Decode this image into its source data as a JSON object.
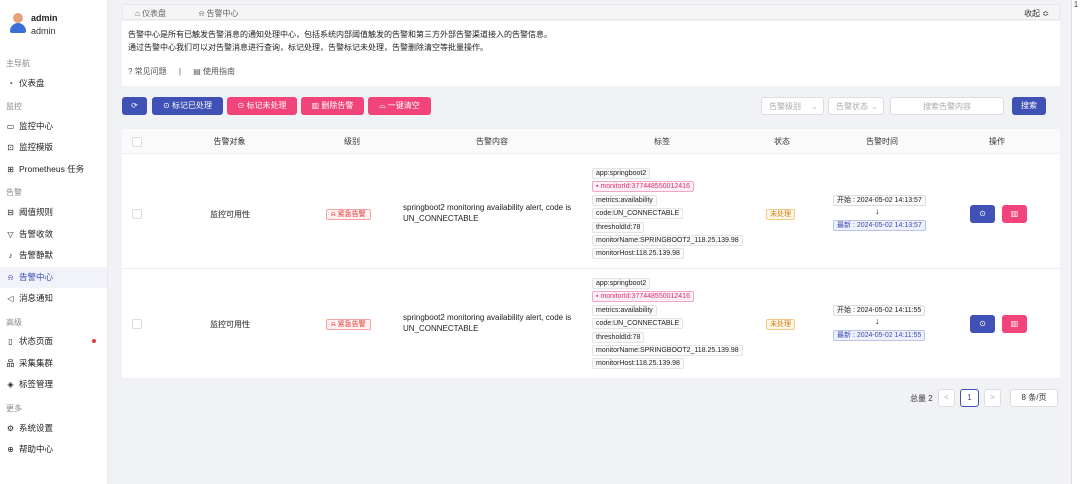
{
  "user": {
    "name": "admin",
    "role": "admin"
  },
  "sidebar": {
    "groups": {
      "main": "主导航",
      "monitor": "监控",
      "alert": "告警",
      "advanced": "高级",
      "more": "更多"
    },
    "items": {
      "dashboard": "仪表盘",
      "monitor_center": "监控中心",
      "monitor_template": "监控模版",
      "prometheus": "Prometheus 任务",
      "threshold": "阈值规则",
      "converge": "告警收敛",
      "silence": "告警静默",
      "alert_center": "告警中心",
      "notice": "消息通知",
      "status_page": "状态页面",
      "collector": "采集集群",
      "label_mgmt": "标签管理",
      "settings": "系统设置",
      "help": "帮助中心"
    }
  },
  "breadcrumb": {
    "home": "仪表盘",
    "current": "告警中心",
    "collapse": "收起 ≎"
  },
  "description": {
    "line1": "告警中心是所有已触发告警消息的通知处理中心，包括系统内部阈值触发的告警和第三方外部告警渠道接入的告警信息。",
    "line2": "通过告警中心我们可以对告警消息进行查询，标记处理，告警标记未处理，告警删除清空等批量操作。",
    "faq": "常见问题",
    "sep": "|",
    "guide": "使用指南"
  },
  "toolbar": {
    "refresh_icon": "⟳",
    "mark_handled": "标记已处理",
    "mark_unhandled": "标记未处理",
    "delete": "删除告警",
    "clear": "一键清空",
    "priority_placeholder": "告警级别",
    "status_placeholder": "告警状态",
    "search_placeholder": "搜索告警内容",
    "search_button": "搜索"
  },
  "table": {
    "headers": {
      "target": "告警对象",
      "level": "级别",
      "content": "告警内容",
      "tags": "标签",
      "status": "状态",
      "time": "告警时间",
      "actions": "操作"
    },
    "rows": [
      {
        "target": "监控可用性",
        "level": "紧急告警",
        "content": "springboot2 monitoring availability alert, code is UN_CONNECTABLE",
        "tags": [
          "app:springboot2",
          "monitorId:377448550012416",
          "metrics:availability",
          "code:UN_CONNECTABLE",
          "thresholdId:78",
          "monitorName:SPRINGBOOT2_118.25.139.98",
          "monitorHost:118.25.139.98"
        ],
        "status": "未处理",
        "start": "开始 : 2024-05-02 14:13:57",
        "arrow": "↓",
        "latest": "最新 : 2024-05-02 14:13:57"
      },
      {
        "target": "监控可用性",
        "level": "紧急告警",
        "content": "springboot2 monitoring availability alert, code is UN_CONNECTABLE",
        "tags": [
          "app:springboot2",
          "monitorId:377448550012416",
          "metrics:availability",
          "code:UN_CONNECTABLE",
          "thresholdId:78",
          "monitorName:SPRINGBOOT2_118.25.139.98",
          "monitorHost:118.25.139.98"
        ],
        "status": "未处理",
        "start": "开始 : 2024-05-02 14:11:55",
        "arrow": "↓",
        "latest": "最新 : 2024-05-02 14:11:55"
      }
    ]
  },
  "pagination": {
    "total": "总量 2",
    "prev": "<",
    "page": "1",
    "next": ">",
    "size": "8 条/页"
  },
  "right_edge": "1"
}
